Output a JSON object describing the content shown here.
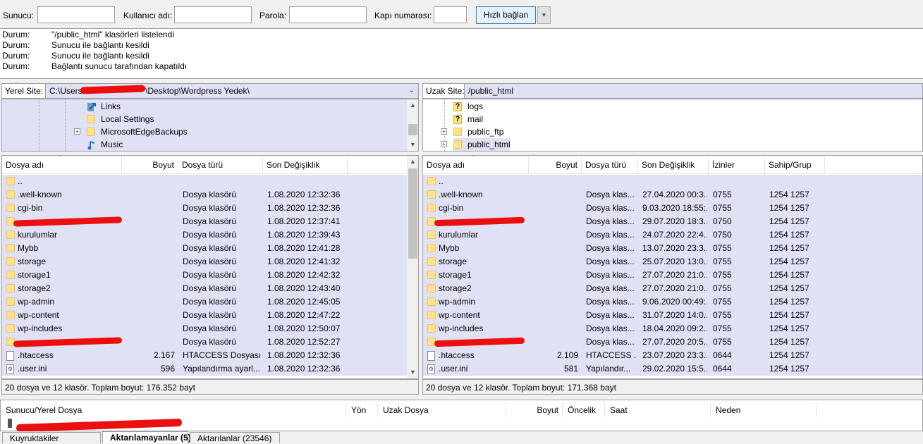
{
  "quickconnect": {
    "host_label": "Sunucu:",
    "user_label": "Kullanıcı adı:",
    "pass_label": "Parola:",
    "port_label": "Kapı numarası:",
    "connect_label": "Hızlı bağlan",
    "host_value": "",
    "user_value": "",
    "pass_value": "",
    "port_value": ""
  },
  "log": [
    {
      "key": "Durum:",
      "msg": "\"/public_html\" klasörleri listelendi"
    },
    {
      "key": "Durum:",
      "msg": "Sunucu ile bağlantı kesildi"
    },
    {
      "key": "Durum:",
      "msg": "Sunucu ile bağlantı kesildi"
    },
    {
      "key": "Durum:",
      "msg": "Bağlantı sunucu tarafından kapatıldı"
    }
  ],
  "local": {
    "site_label": "Yerel Site:",
    "path_start": "C:\\Users\\",
    "path_end": "\\Desktop\\Wordpress Yedek\\",
    "tree": [
      "Links",
      "Local Settings",
      "MicrosoftEdgeBackups",
      "Music"
    ],
    "columns": {
      "name": "Dosya adı",
      "size": "Boyut",
      "type": "Dosya türü",
      "modified": "Son Değişiklik"
    },
    "files": [
      {
        "name": "..",
        "size": "",
        "type": "",
        "modified": ""
      },
      {
        "name": ".well-known",
        "size": "",
        "type": "Dosya klasörü",
        "modified": "1.08.2020 12:32:36"
      },
      {
        "name": "cgi-bin",
        "size": "",
        "type": "Dosya klasörü",
        "modified": "1.08.2020 12:32:36"
      },
      {
        "name": "",
        "size": "",
        "type": "Dosya klasörü",
        "modified": "1.08.2020 12:37:41"
      },
      {
        "name": "kurulumlar",
        "size": "",
        "type": "Dosya klasörü",
        "modified": "1.08.2020 12:39:43"
      },
      {
        "name": "Mybb",
        "size": "",
        "type": "Dosya klasörü",
        "modified": "1.08.2020 12:41:28"
      },
      {
        "name": "storage",
        "size": "",
        "type": "Dosya klasörü",
        "modified": "1.08.2020 12:41:32"
      },
      {
        "name": "storage1",
        "size": "",
        "type": "Dosya klasörü",
        "modified": "1.08.2020 12:42:32"
      },
      {
        "name": "storage2",
        "size": "",
        "type": "Dosya klasörü",
        "modified": "1.08.2020 12:43:40"
      },
      {
        "name": "wp-admin",
        "size": "",
        "type": "Dosya klasörü",
        "modified": "1.08.2020 12:45:05"
      },
      {
        "name": "wp-content",
        "size": "",
        "type": "Dosya klasörü",
        "modified": "1.08.2020 12:47:22"
      },
      {
        "name": "wp-includes",
        "size": "",
        "type": "Dosya klasörü",
        "modified": "1.08.2020 12:50:07"
      },
      {
        "name": "",
        "size": "",
        "type": "Dosya klasörü",
        "modified": "1.08.2020 12:52:27"
      },
      {
        "name": ".htaccess",
        "size": "2.167",
        "type": "HTACCESS Dosyası",
        "modified": "1.08.2020 12:32:36"
      },
      {
        "name": ".user.ini",
        "size": "596",
        "type": "Yapılandırma ayarl...",
        "modified": "1.08.2020 12:32:36"
      }
    ],
    "status": "20 dosya ve 12 klasör. Toplam boyut: 176.352 bayt"
  },
  "remote": {
    "site_label": "Uzak Site:",
    "path": "/public_html",
    "tree": [
      "logs",
      "mail",
      "public_ftp",
      "public_html"
    ],
    "columns": {
      "name": "Dosya adı",
      "size": "Boyut",
      "type": "Dosya türü",
      "modified": "Son Değişiklik",
      "perms": "İzinler",
      "owner": "Sahip/Grup"
    },
    "files": [
      {
        "name": "..",
        "size": "",
        "type": "",
        "modified": "",
        "perms": "",
        "owner": ""
      },
      {
        "name": ".well-known",
        "size": "",
        "type": "Dosya klas...",
        "modified": "27.04.2020 00:3...",
        "perms": "0755",
        "owner": "1254 1257"
      },
      {
        "name": "cgi-bin",
        "size": "",
        "type": "Dosya klas...",
        "modified": "9.03.2020 18:55:...",
        "perms": "0755",
        "owner": "1254 1257"
      },
      {
        "name": "",
        "size": "",
        "type": "Dosya klas...",
        "modified": "29.07.2020 18:3...",
        "perms": "0750",
        "owner": "1254 1257"
      },
      {
        "name": "kurulumlar",
        "size": "",
        "type": "Dosya klas...",
        "modified": "24.07.2020 22:4...",
        "perms": "0750",
        "owner": "1254 1257"
      },
      {
        "name": "Mybb",
        "size": "",
        "type": "Dosya klas...",
        "modified": "13.07.2020 23:3...",
        "perms": "0755",
        "owner": "1254 1257"
      },
      {
        "name": "storage",
        "size": "",
        "type": "Dosya klas...",
        "modified": "25.07.2020 13:0...",
        "perms": "0755",
        "owner": "1254 1257"
      },
      {
        "name": "storage1",
        "size": "",
        "type": "Dosya klas...",
        "modified": "27.07.2020 21:0...",
        "perms": "0755",
        "owner": "1254 1257"
      },
      {
        "name": "storage2",
        "size": "",
        "type": "Dosya klas...",
        "modified": "27.07.2020 21:0...",
        "perms": "0755",
        "owner": "1254 1257"
      },
      {
        "name": "wp-admin",
        "size": "",
        "type": "Dosya klas...",
        "modified": "9.06.2020 00:49:...",
        "perms": "0755",
        "owner": "1254 1257"
      },
      {
        "name": "wp-content",
        "size": "",
        "type": "Dosya klas...",
        "modified": "31.07.2020 14:0...",
        "perms": "0755",
        "owner": "1254 1257"
      },
      {
        "name": "wp-includes",
        "size": "",
        "type": "Dosya klas...",
        "modified": "18.04.2020 09:2...",
        "perms": "0755",
        "owner": "1254 1257"
      },
      {
        "name": "",
        "size": "",
        "type": "Dosya klas...",
        "modified": "27.07.2020 20:5...",
        "perms": "0755",
        "owner": "1254 1257"
      },
      {
        "name": ".htaccess",
        "size": "2.109",
        "type": "HTACCESS ...",
        "modified": "23.07.2020 23:3...",
        "perms": "0644",
        "owner": "1254 1257"
      },
      {
        "name": ".user.ini",
        "size": "581",
        "type": "Yapılandır...",
        "modified": "29.02.2020 15:5...",
        "perms": "0644",
        "owner": "1254 1257"
      }
    ],
    "status": "20 dosya ve 12 klasör. Toplam boyut: 171.368 bayt"
  },
  "queue": {
    "columns": [
      "Sunucu/Yerel Dosya",
      "Yön",
      "Uzak Dosya",
      "Boyut",
      "Öncelik",
      "Saat",
      "Neden"
    ]
  },
  "tabs": [
    {
      "label": "Kuyruktakiler"
    },
    {
      "label": "Aktarılamayanlar (5)"
    },
    {
      "label": "Aktarılanlar (23546)"
    }
  ],
  "colors": {
    "selection": "#e1e1f5",
    "folder": "#ffe28a",
    "redaction": "#ec0f0f"
  }
}
